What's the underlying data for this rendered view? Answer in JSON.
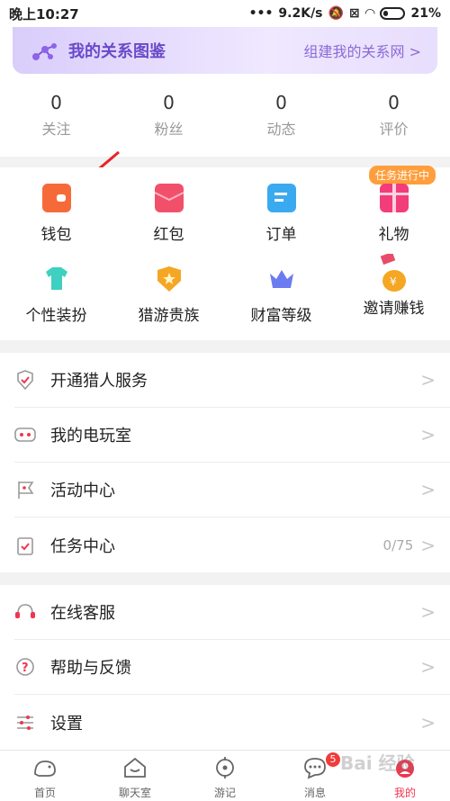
{
  "status_bar": {
    "time": "晚上10:27",
    "speed": "9.2K/s",
    "battery": "21%"
  },
  "banner": {
    "title": "我的关系图鉴",
    "link": "组建我的关系网 >"
  },
  "stats": [
    {
      "value": "0",
      "label": "关注"
    },
    {
      "value": "0",
      "label": "粉丝"
    },
    {
      "value": "0",
      "label": "动态"
    },
    {
      "value": "0",
      "label": "评价"
    }
  ],
  "grid": {
    "badge": "任务进行中",
    "items": [
      {
        "label": "钱包",
        "icon": "wallet-icon",
        "color": "#f66a3a"
      },
      {
        "label": "红包",
        "icon": "red-packet-icon",
        "color": "#f2506a"
      },
      {
        "label": "订单",
        "icon": "order-icon",
        "color": "#3aaaf0"
      },
      {
        "label": "礼物",
        "icon": "gift-icon",
        "color": "#f33c7a"
      },
      {
        "label": "个性装扮",
        "icon": "tshirt-icon",
        "color": "#3ed0c0"
      },
      {
        "label": "猎游贵族",
        "icon": "noble-badge-icon",
        "color": "#f5a623"
      },
      {
        "label": "财富等级",
        "icon": "crown-icon",
        "color": "#6b7cf0"
      },
      {
        "label": "邀请赚钱",
        "icon": "money-bag-icon",
        "color": "#f5a623"
      }
    ]
  },
  "menu1": [
    {
      "label": "开通猎人服务",
      "icon": "shield-check-icon"
    },
    {
      "label": "我的电玩室",
      "icon": "gamepad-icon"
    },
    {
      "label": "活动中心",
      "icon": "flag-icon"
    },
    {
      "label": "任务中心",
      "icon": "clipboard-check-icon",
      "value": "0/75"
    }
  ],
  "menu2": [
    {
      "label": "在线客服",
      "icon": "headset-icon"
    },
    {
      "label": "帮助与反馈",
      "icon": "help-icon"
    },
    {
      "label": "设置",
      "icon": "settings-icon"
    }
  ],
  "chevron": ">",
  "tabbar": [
    {
      "label": "首页",
      "icon": "home-icon"
    },
    {
      "label": "聊天室",
      "icon": "chat-room-icon"
    },
    {
      "label": "游记",
      "icon": "target-icon"
    },
    {
      "label": "消息",
      "icon": "message-icon",
      "badge": "5"
    },
    {
      "label": "我的",
      "icon": "profile-icon",
      "active": true
    }
  ],
  "watermark": "Bai 经验"
}
